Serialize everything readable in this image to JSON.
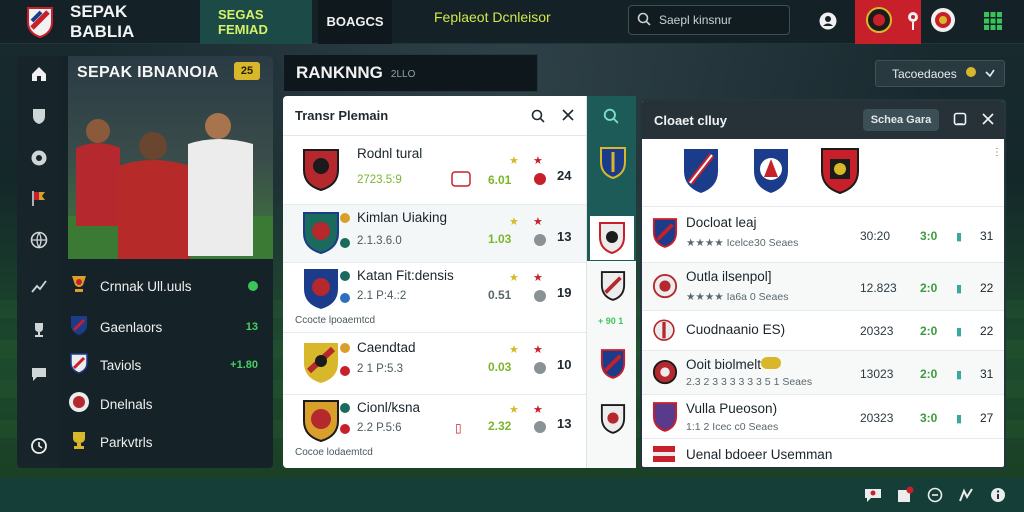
{
  "app": {
    "brand": "SEPAK BABLIA",
    "tabs": [
      "SEGAS FEMIAD",
      "BOAGCS"
    ],
    "search_placeholder": "Saepl kinsnur",
    "accent_red": "#c8202a",
    "accent_lime": "#d6f26a"
  },
  "sidebar": {
    "icons": [
      "home-icon",
      "shield-icon",
      "ball-icon",
      "flag-icon",
      "globe-icon",
      "stats-icon",
      "trophy-icon",
      "chat-icon",
      "clock-icon"
    ]
  },
  "left_card": {
    "title": "SEPAK IBNANOIA",
    "badge": "25",
    "list": [
      {
        "label": "Crnnak Ull.uuls",
        "value": "",
        "icon": "trophy-icon"
      },
      {
        "label": "Gaenlaors",
        "value": "13",
        "icon": "crest-icon"
      },
      {
        "label": "Taviols",
        "value": "+1.80",
        "icon": "crest-icon"
      },
      {
        "label": "Dnelnals",
        "value": "",
        "icon": "crest-icon"
      },
      {
        "label": "Parkvtrls",
        "value": "",
        "icon": "cup-icon"
      }
    ]
  },
  "ranking": {
    "title": "RANKNNG",
    "subtitle": "2LLO",
    "select_label": "Tacoedaoes"
  },
  "transfer_panel": {
    "title": "Transr Plemain",
    "rows": [
      {
        "name": "Rodnl tural",
        "sub": "2723.5:9",
        "score": "6.01",
        "rank": "24",
        "foot": ""
      },
      {
        "name": "Kimlan Uiaking",
        "sub": "2.1.3.6.0",
        "score": "1.03",
        "rank": "13",
        "foot": ""
      },
      {
        "name": "Katan Fit:densis",
        "sub": "2.1 P:4.:2",
        "score": "0.51",
        "rank": "19",
        "foot": "Ccocte lpoaemtcd"
      },
      {
        "name": "Caendtad",
        "sub": "2 1 P:5.3",
        "score": "0.03",
        "rank": "10",
        "foot": ""
      },
      {
        "name": "Cionl/ksna",
        "sub": "2.2 P.5:6",
        "score": "2.32",
        "rank": "13",
        "foot": "Cocoe lodaemtcd"
      }
    ],
    "side_values": [
      "+ 90 1"
    ]
  },
  "right_panel": {
    "title": "Cloaet clluy",
    "pill": "Schea Gara",
    "rows": [
      {
        "name": "Docloat leaj",
        "sub": "★★★★  Icelce30 Seaes",
        "c1": "30:20",
        "c2": "3:0",
        "c3": "31"
      },
      {
        "name": "Outla ilsenpol]",
        "sub": "★★★★  Ia6a 0 Seaes",
        "c1": "12.823",
        "c2": "2:0",
        "c3": "22"
      },
      {
        "name": "Cuodnaanio ES)",
        "sub": "",
        "c1": "20323",
        "c2": "2:0",
        "c3": "22"
      },
      {
        "name": "Ooit biolmelt",
        "sub": "2.3 2 3 3 3 3 3 3 5 1 Seaes",
        "c1": "13023",
        "c2": "2:0",
        "c3": "31"
      },
      {
        "name": "Vulla Pueoson)",
        "sub": "1:1 2 Icec c0 Seaes",
        "c1": "20323",
        "c2": "3:0",
        "c3": "27"
      },
      {
        "name": "Uenal bdoeer Usemman",
        "sub": "",
        "c1": "",
        "c2": "",
        "c3": ""
      }
    ]
  },
  "footer": {
    "text": "Feplaeot Dcnleisor"
  }
}
